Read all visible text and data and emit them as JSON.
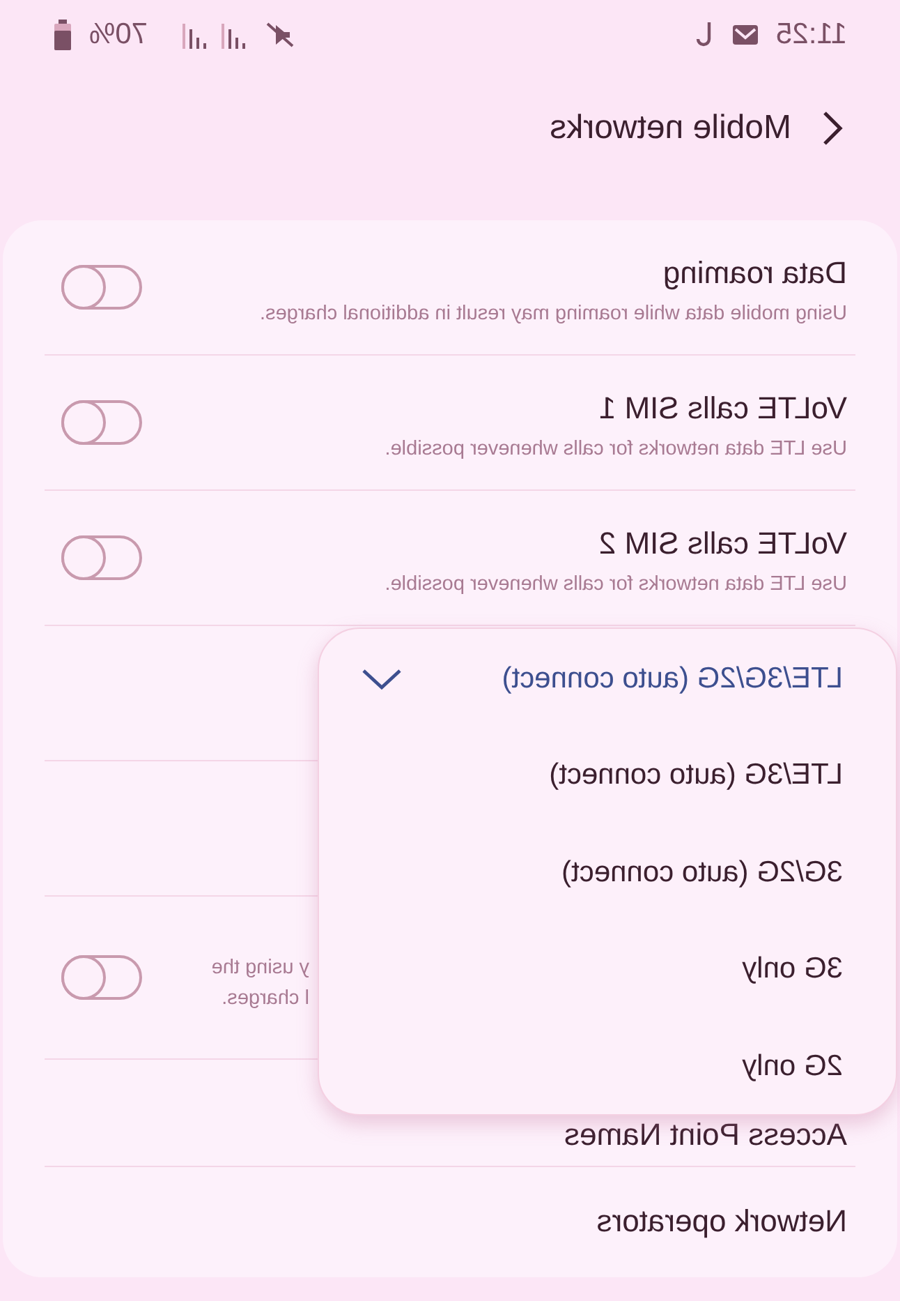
{
  "status_bar": {
    "time": "11:25",
    "battery": "70%"
  },
  "header": {
    "title": "Mobile networks"
  },
  "rows": [
    {
      "kind": "toggle",
      "title": "Data roaming",
      "description": [
        "Using mobile data while roaming may result in additional charges."
      ],
      "on": false
    },
    {
      "kind": "toggle",
      "title": "VoLTE calls SIM 1",
      "description": [
        "Use LTE data networks for calls whenever possible."
      ],
      "on": false
    },
    {
      "kind": "toggle",
      "title": "VoLTE calls SIM 2",
      "description": [
        "Use LTE data networks for calls whenever possible."
      ],
      "on": false
    },
    {
      "kind": "empty"
    },
    {
      "kind": "empty"
    },
    {
      "kind": "toggle",
      "description": [
        "y using the",
        "l charges."
      ],
      "on": false
    },
    {
      "kind": "link",
      "title": "Access Point Names"
    },
    {
      "kind": "link",
      "title": "Network operators"
    }
  ],
  "network_mode_menu": [
    {
      "label": "LTE/3G/2G (auto connect)",
      "selected": true
    },
    {
      "label": "LTE/3G (auto connect)",
      "selected": false
    },
    {
      "label": "3G/2G (auto connect)",
      "selected": false
    },
    {
      "label": "3G only",
      "selected": false
    },
    {
      "label": "2G only",
      "selected": false
    }
  ]
}
